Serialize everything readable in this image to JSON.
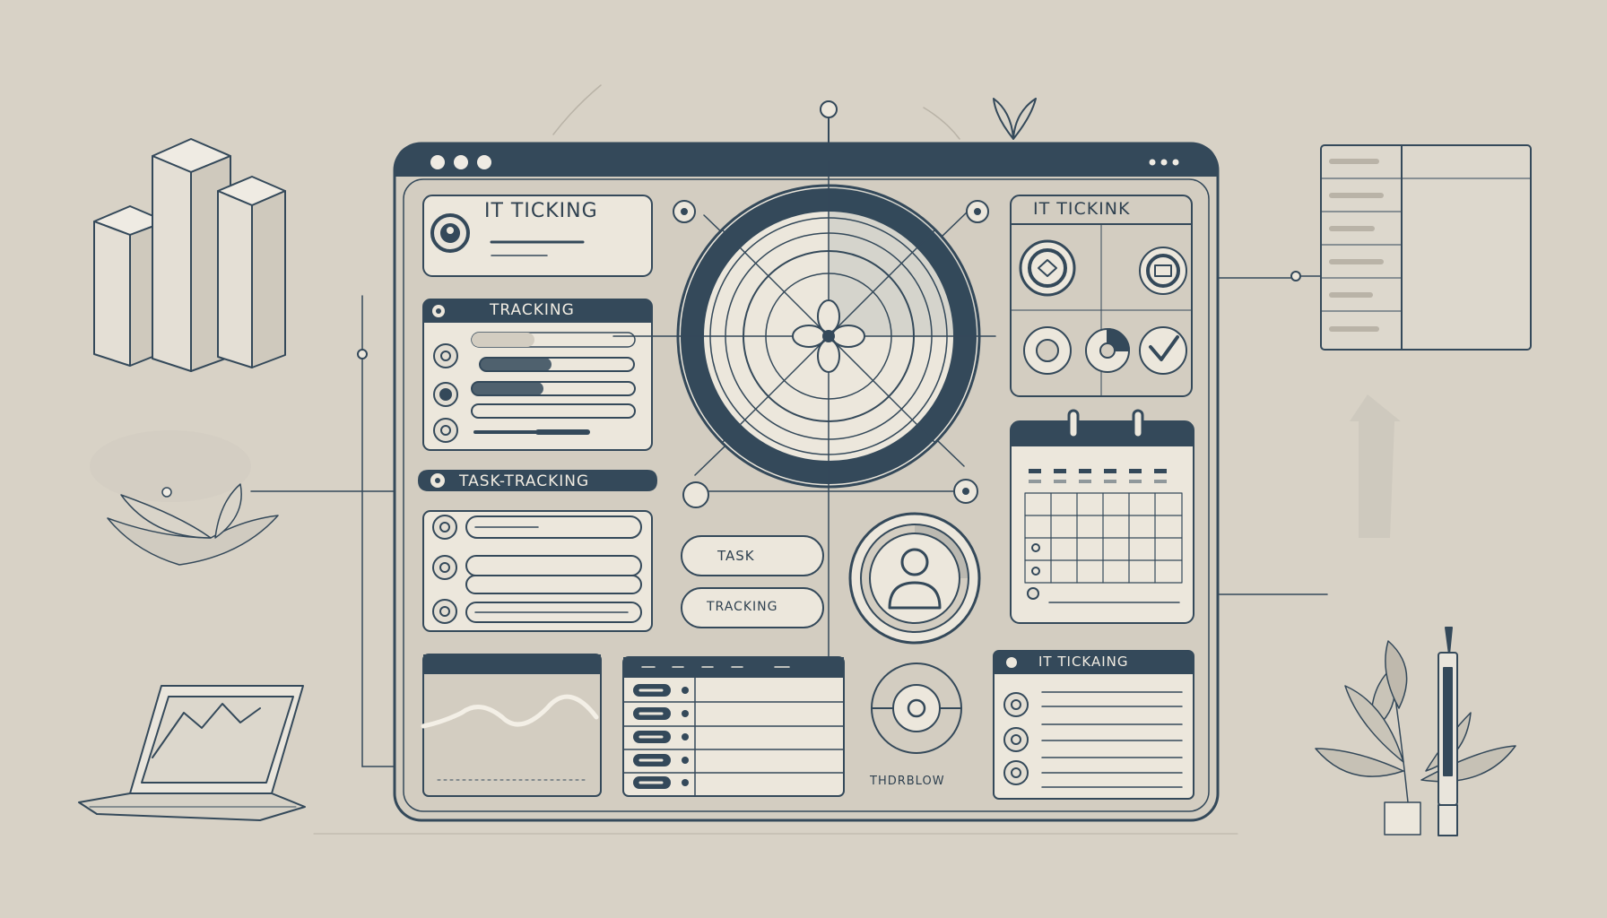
{
  "palette": {
    "background": "#d8d2c6",
    "ink": "#34495a",
    "paper": "#ece7dc",
    "panel": "#d3cdc1"
  },
  "window": {
    "controls": [
      "dot",
      "dot",
      "dot"
    ]
  },
  "panels": {
    "it_ticking": {
      "title": "IT TICKING",
      "icon": "badge-icon"
    },
    "tracking": {
      "title": "TRACKING",
      "rows": 4
    },
    "task_tracking": {
      "title": "TASK-TRACKING",
      "rows": 3
    },
    "it_tickink": {
      "title": "IT TICKINK"
    },
    "task_button": {
      "label": "TASK"
    },
    "tracking_button": {
      "label": "TRACKING"
    },
    "workflow_label": {
      "text": "THDRBLOW"
    },
    "it_tickaing": {
      "title": "IT TICKAING"
    }
  },
  "icons": [
    "badge-icon",
    "flower-icon",
    "user-icon",
    "checkmark-icon",
    "calendar-icon",
    "bar-chart-icon",
    "laptop-icon",
    "plant-icon",
    "pen-icon",
    "leaf-icon",
    "arrow-icon"
  ]
}
